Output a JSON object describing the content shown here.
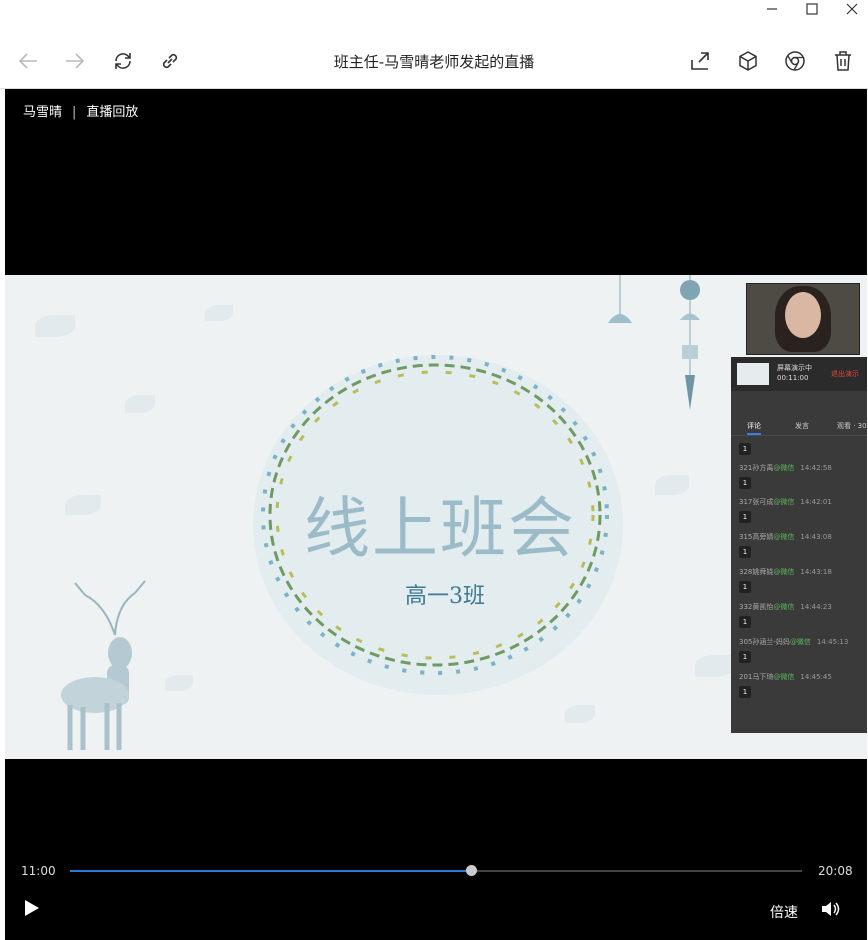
{
  "window": {
    "title": "班主任-马雪晴老师发起的直播",
    "icons": [
      "minimize-icon",
      "maximize-icon",
      "close-icon",
      "back-icon",
      "forward-icon",
      "refresh-icon",
      "link-icon",
      "share-icon",
      "cube-icon",
      "chrome-icon",
      "trash-icon"
    ]
  },
  "breadcrumb": {
    "name": "马雪晴",
    "sep": "|",
    "label": "直播回放"
  },
  "slide": {
    "title": "线上班会",
    "subtitle": "高一3班"
  },
  "panel": {
    "status": "屏幕演示中",
    "time": "00:11:00",
    "exit": "退出演示",
    "tabs": [
      "评论",
      "发言",
      "观看 · 30"
    ],
    "comments": [
      {
        "name": "321孙方禹",
        "src": "@微信",
        "time": "14:42:58",
        "badge": "1"
      },
      {
        "name": "317张可成",
        "src": "@微信",
        "time": "14:42:01",
        "badge": "1"
      },
      {
        "name": "315高旁婧",
        "src": "@微信",
        "time": "14:43:08",
        "badge": "1"
      },
      {
        "name": "328姚舜娆",
        "src": "@微信",
        "time": "14:43:18",
        "badge": "1"
      },
      {
        "name": "332黄凯怡",
        "src": "@微信",
        "time": "14:44:23",
        "badge": "1"
      },
      {
        "name": "305孙涵兰-妈妈",
        "src": "@微信",
        "time": "14:45:13",
        "badge": "1"
      },
      {
        "name": "201马下琦",
        "src": "@微信",
        "time": "14:45:45",
        "badge": "1"
      }
    ]
  },
  "controls": {
    "current": "11:00",
    "total": "20:08",
    "progress": 0.548,
    "speed": "倍速"
  }
}
